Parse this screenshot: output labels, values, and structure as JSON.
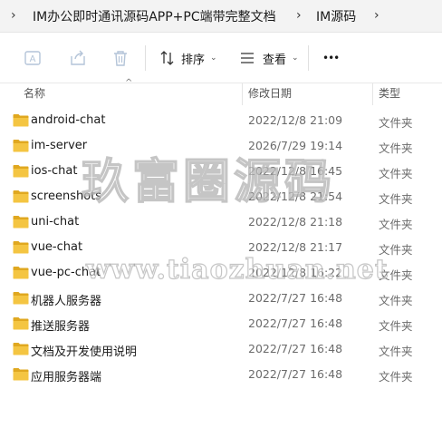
{
  "breadcrumb": {
    "items": [
      "IM办公即时通讯源码APP+PC端带完整文档",
      "IM源码"
    ]
  },
  "toolbar": {
    "sort_label": "排序",
    "view_label": "查看",
    "more_label": "•••"
  },
  "columns": {
    "name": "名称",
    "date": "修改日期",
    "type": "类型"
  },
  "files": [
    {
      "name": "android-chat",
      "date": "2022/12/8 21:09",
      "type": "文件夹"
    },
    {
      "name": "im-server",
      "date": "2026/7/29 19:14",
      "type": "文件夹"
    },
    {
      "name": "ios-chat",
      "date": "2022/12/8 16:45",
      "type": "文件夹"
    },
    {
      "name": "screenshots",
      "date": "2022/12/8 21:54",
      "type": "文件夹"
    },
    {
      "name": "uni-chat",
      "date": "2022/12/8 21:18",
      "type": "文件夹"
    },
    {
      "name": "vue-chat",
      "date": "2022/12/8 21:17",
      "type": "文件夹"
    },
    {
      "name": "vue-pc-chat",
      "date": "2022/12/8 16:22",
      "type": "文件夹"
    },
    {
      "name": "机器人服务器",
      "date": "2022/7/27 16:48",
      "type": "文件夹"
    },
    {
      "name": "推送服务器",
      "date": "2022/7/27 16:48",
      "type": "文件夹"
    },
    {
      "name": "文档及开发使用说明",
      "date": "2022/7/27 16:48",
      "type": "文件夹"
    },
    {
      "name": "应用服务器端",
      "date": "2022/7/27 16:48",
      "type": "文件夹"
    }
  ],
  "watermark": {
    "line1": "玖富圈源码",
    "line2": "www.tiaozhuan.net"
  },
  "colors": {
    "folder": "#f4c542",
    "folder_dark": "#e0a820",
    "toolbar_icon_disabled": "#b4c4d8"
  }
}
